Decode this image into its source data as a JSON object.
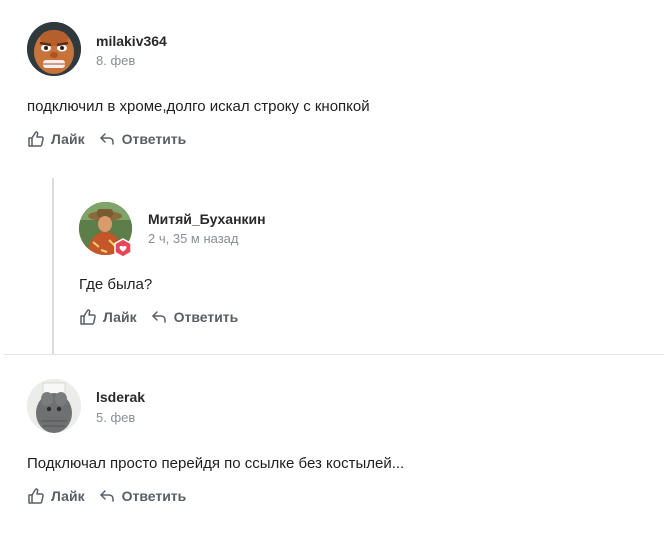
{
  "comments": [
    {
      "author": "milakiv364",
      "time": "8. фев",
      "text": "подключил в хроме,долго искал строку с кнопкой",
      "like_label": "Лайк",
      "reply_label": "Ответить",
      "avatar_icon": "cartoon-face-avatar"
    },
    {
      "author": "Митяй_Буханкин",
      "time": "2 ч, 35 м назад",
      "text": "Где была?",
      "like_label": "Лайк",
      "reply_label": "Ответить",
      "avatar_icon": "photo-avatar",
      "badge_icon": "heart-badge-icon",
      "is_reply": true
    },
    {
      "author": "lsderak",
      "time": "5. фев",
      "text": "Подключал просто перейдя по ссылке без костылей...",
      "like_label": "Лайк",
      "reply_label": "Ответить",
      "avatar_icon": "knitted-figure-avatar"
    }
  ],
  "colors": {
    "author": "#2a2a2a",
    "time": "#8a8f96",
    "action": "#5a5f66",
    "badge": "#e8455b",
    "thread_line": "#d9dcdf"
  }
}
